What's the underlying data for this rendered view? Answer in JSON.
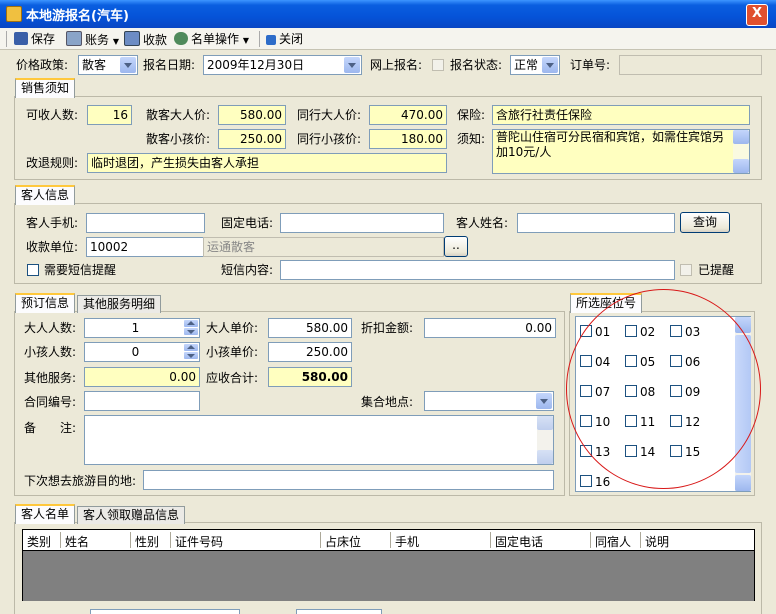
{
  "window": {
    "title": "本地游报名(汽车)",
    "close": "X"
  },
  "toolbar": {
    "save": "保存",
    "account": "账务",
    "collect": "收款",
    "roster": "名单操作",
    "close": "关闭"
  },
  "topbar": {
    "price_policy_label": "价格政策:",
    "price_policy_value": "散客",
    "signup_date_label": "报名日期:",
    "signup_date_value": "2009年12月30日",
    "online_signup_label": "网上报名:",
    "status_label": "报名状态:",
    "status_value": "正常",
    "order_no_label": "订单号:",
    "order_no_value": ""
  },
  "sales": {
    "tab": "销售须知",
    "capacity_label": "可收人数:",
    "capacity_value": "16",
    "adult_price_label": "散客大人价:",
    "adult_price_value": "580.00",
    "peer_adult_label": "同行大人价:",
    "peer_adult_value": "470.00",
    "insurance_label": "保险:",
    "insurance_value": "含旅行社责任保险",
    "child_price_label": "散客小孩价:",
    "child_price_value": "250.00",
    "peer_child_label": "同行小孩价:",
    "peer_child_value": "180.00",
    "notice_label": "须知:",
    "notice_value": "普陀山住宿可分民宿和宾馆，如需住宾馆另加10元/人",
    "refund_label": "改退规则:",
    "refund_value": "临时退团，产生损失由客人承担"
  },
  "guest": {
    "tab": "客人信息",
    "mobile_label": "客人手机:",
    "mobile_value": "",
    "phone_label": "固定电话:",
    "phone_value": "",
    "name_label": "客人姓名:",
    "name_value": "",
    "query_button": "查询",
    "payer_label": "收款单位:",
    "payer_code": "10002",
    "payer_name": "运通散客",
    "browse": "..",
    "sms_reminder_label": "需要短信提醒",
    "sms_content_label": "短信内容:",
    "sms_content_value": "",
    "reminded_label": "已提醒"
  },
  "booking": {
    "tab_active": "预订信息",
    "tab_other": "其他服务明细",
    "adults_label": "大人人数:",
    "adults_value": "1",
    "adult_unit_label": "大人单价:",
    "adult_unit_value": "580.00",
    "discount_label": "折扣金额:",
    "discount_value": "0.00",
    "children_label": "小孩人数:",
    "children_value": "0",
    "child_unit_label": "小孩单价:",
    "child_unit_value": "250.00",
    "other_label": "其他服务:",
    "other_value": "0.00",
    "total_label": "应收合计:",
    "total_value": "580.00",
    "contract_label": "合同编号:",
    "contract_value": "",
    "meet_label": "集合地点:",
    "meet_value": "",
    "remark_label": "备　　注:",
    "remark_value": "",
    "next_dest_label": "下次想去旅游目的地:",
    "next_dest_value": ""
  },
  "seats": {
    "tab": "所选座位号",
    "items": [
      "01",
      "02",
      "03",
      "04",
      "05",
      "06",
      "07",
      "08",
      "09",
      "10",
      "11",
      "12",
      "13",
      "14",
      "15",
      "16"
    ]
  },
  "roster": {
    "tab_active": "客人名单",
    "tab_other": "客人领取赠品信息",
    "columns": [
      "类别",
      "姓名",
      "性别",
      "证件号码",
      "占床位",
      "手机",
      "固定电话",
      "同宿人",
      "说明"
    ]
  }
}
